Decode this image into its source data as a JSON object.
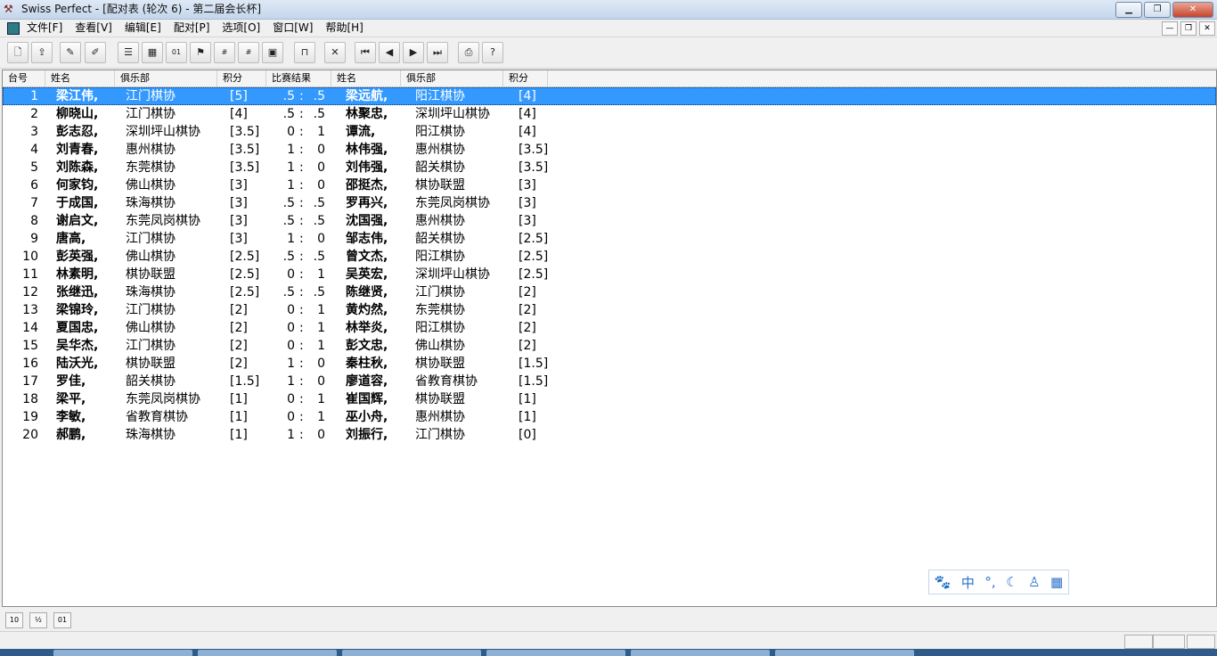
{
  "window": {
    "title": "Swiss Perfect - [配对表  (轮次 6) - 第二届会长杯]"
  },
  "menu": {
    "items": [
      "文件[F]",
      "查看[V]",
      "编辑[E]",
      "配对[P]",
      "选项[O]",
      "窗口[W]",
      "帮助[H]"
    ]
  },
  "toolbar": {
    "icons": [
      "new-tournament-icon",
      "export-icon",
      "edit-pencil-icon",
      "edit-pencil-2-icon",
      "player-list-icon",
      "table-view-icon",
      "pairings-binary-icon",
      "results-icon",
      "ratings-2285-icon",
      "numbers-1236-icon",
      "crosstable-icon",
      "table-icon",
      "cross-icon",
      "first-icon",
      "prev-icon",
      "next-icon",
      "last-icon",
      "print-icon",
      "help-icon"
    ]
  },
  "table": {
    "headers": [
      "台号",
      "姓名",
      "俱乐部",
      "积分",
      "比赛结果",
      "姓名",
      "俱乐部",
      "积分"
    ],
    "rows": [
      {
        "board": "1",
        "name1": "梁江伟,",
        "club1": "江门棋协",
        "pts1": "[5]",
        "s1": ".5",
        "s2": ".5",
        "name2": "梁远航,",
        "club2": "阳江棋协",
        "pts2": "[4]"
      },
      {
        "board": "2",
        "name1": "柳晓山,",
        "club1": "江门棋协",
        "pts1": "[4]",
        "s1": ".5",
        "s2": ".5",
        "name2": "林聚忠,",
        "club2": "深圳坪山棋协",
        "pts2": "[4]"
      },
      {
        "board": "3",
        "name1": "彭志忍,",
        "club1": "深圳坪山棋协",
        "pts1": "[3.5]",
        "s1": "0",
        "s2": "1",
        "name2": "谭流,",
        "club2": "阳江棋协",
        "pts2": "[4]"
      },
      {
        "board": "4",
        "name1": "刘青春,",
        "club1": "惠州棋协",
        "pts1": "[3.5]",
        "s1": "1",
        "s2": "0",
        "name2": "林伟强,",
        "club2": "惠州棋协",
        "pts2": "[3.5]"
      },
      {
        "board": "5",
        "name1": "刘陈森,",
        "club1": "东莞棋协",
        "pts1": "[3.5]",
        "s1": "1",
        "s2": "0",
        "name2": "刘伟强,",
        "club2": "韶关棋协",
        "pts2": "[3.5]"
      },
      {
        "board": "6",
        "name1": "何家钧,",
        "club1": "佛山棋协",
        "pts1": "[3]",
        "s1": "1",
        "s2": "0",
        "name2": "邵挺杰,",
        "club2": "棋协联盟",
        "pts2": "[3]"
      },
      {
        "board": "7",
        "name1": "于成国,",
        "club1": "珠海棋协",
        "pts1": "[3]",
        "s1": ".5",
        "s2": ".5",
        "name2": "罗再兴,",
        "club2": "东莞凤岗棋协",
        "pts2": "[3]"
      },
      {
        "board": "8",
        "name1": "谢启文,",
        "club1": "东莞凤岗棋协",
        "pts1": "[3]",
        "s1": ".5",
        "s2": ".5",
        "name2": "沈国强,",
        "club2": "惠州棋协",
        "pts2": "[3]"
      },
      {
        "board": "9",
        "name1": "唐高,",
        "club1": "江门棋协",
        "pts1": "[3]",
        "s1": "1",
        "s2": "0",
        "name2": "邹志伟,",
        "club2": "韶关棋协",
        "pts2": "[2.5]"
      },
      {
        "board": "10",
        "name1": "彭英强,",
        "club1": "佛山棋协",
        "pts1": "[2.5]",
        "s1": ".5",
        "s2": ".5",
        "name2": "曾文杰,",
        "club2": "阳江棋协",
        "pts2": "[2.5]"
      },
      {
        "board": "11",
        "name1": "林素明,",
        "club1": "棋协联盟",
        "pts1": "[2.5]",
        "s1": "0",
        "s2": "1",
        "name2": "吴英宏,",
        "club2": "深圳坪山棋协",
        "pts2": "[2.5]"
      },
      {
        "board": "12",
        "name1": "张继迅,",
        "club1": "珠海棋协",
        "pts1": "[2.5]",
        "s1": ".5",
        "s2": ".5",
        "name2": "陈继贤,",
        "club2": "江门棋协",
        "pts2": "[2]"
      },
      {
        "board": "13",
        "name1": "梁锦玲,",
        "club1": "江门棋协",
        "pts1": "[2]",
        "s1": "0",
        "s2": "1",
        "name2": "黄灼然,",
        "club2": "东莞棋协",
        "pts2": "[2]"
      },
      {
        "board": "14",
        "name1": "夏国忠,",
        "club1": "佛山棋协",
        "pts1": "[2]",
        "s1": "0",
        "s2": "1",
        "name2": "林举炎,",
        "club2": "阳江棋协",
        "pts2": "[2]"
      },
      {
        "board": "15",
        "name1": "吴华杰,",
        "club1": "江门棋协",
        "pts1": "[2]",
        "s1": "0",
        "s2": "1",
        "name2": "彭文忠,",
        "club2": "佛山棋协",
        "pts2": "[2]"
      },
      {
        "board": "16",
        "name1": "陆沃光,",
        "club1": "棋协联盟",
        "pts1": "[2]",
        "s1": "1",
        "s2": "0",
        "name2": "秦柱秋,",
        "club2": "棋协联盟",
        "pts2": "[1.5]"
      },
      {
        "board": "17",
        "name1": "罗佳,",
        "club1": "韶关棋协",
        "pts1": "[1.5]",
        "s1": "1",
        "s2": "0",
        "name2": "廖道容,",
        "club2": "省教育棋协",
        "pts2": "[1.5]"
      },
      {
        "board": "18",
        "name1": "梁平,",
        "club1": "东莞凤岗棋协",
        "pts1": "[1]",
        "s1": "0",
        "s2": "1",
        "name2": "崔国辉,",
        "club2": "棋协联盟",
        "pts2": "[1]"
      },
      {
        "board": "19",
        "name1": "李敏,",
        "club1": "省教育棋协",
        "pts1": "[1]",
        "s1": "0",
        "s2": "1",
        "name2": "巫小舟,",
        "club2": "惠州棋协",
        "pts2": "[1]"
      },
      {
        "board": "20",
        "name1": "郝鹏,",
        "club1": "珠海棋协",
        "pts1": "[1]",
        "s1": "1",
        "s2": "0",
        "name2": "刘振行,",
        "club2": "江门棋协",
        "pts2": "[0]"
      }
    ],
    "selected_row": 0,
    "score_separator": ":"
  },
  "ime": {
    "icons": [
      "paw-icon",
      "chinese-mode-icon",
      "punctuation-icon",
      "moon-icon",
      "user-icon",
      "grid-icon"
    ],
    "mode_label": "中"
  },
  "colors": {
    "selection": "#3399ff",
    "titlebar": "#c4d6ec"
  }
}
